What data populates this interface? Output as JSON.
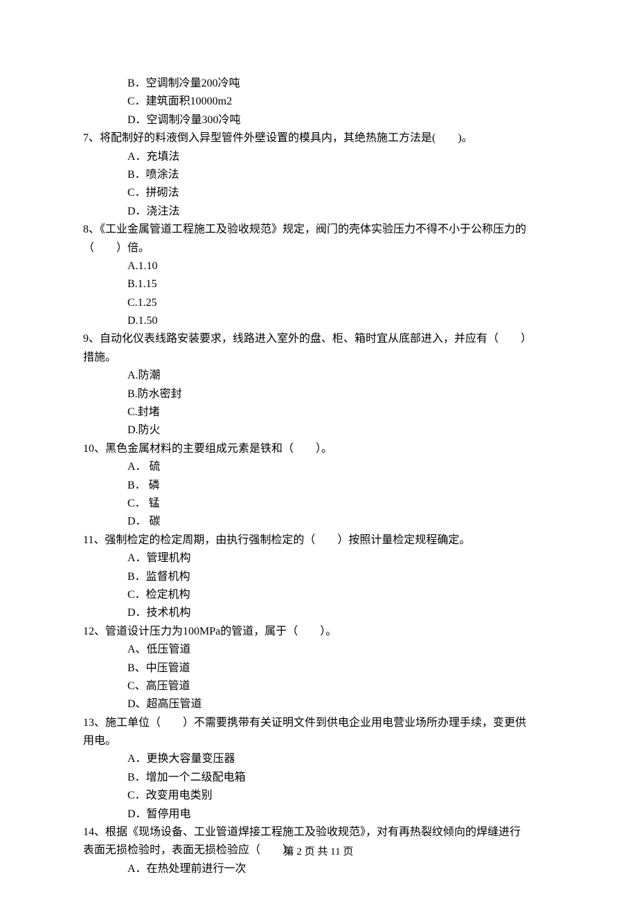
{
  "q6_options": {
    "B": "B．空调制冷量200冷吨",
    "C": "C．建筑面积10000m2",
    "D": "D．空调制冷量300冷吨"
  },
  "q7": {
    "stem": "7、将配制好的料液倒入异型管件外壁设置的模具内，其绝热施工方法是(　　)。",
    "A": "A．充填法",
    "B": "B．喷涂法",
    "C": "C．拼砌法",
    "D": "D．浇注法"
  },
  "q8": {
    "stem_line1": "8、《工业金属管道工程施工及验收规范》规定，阀门的壳体实验压力不得不小于公称压力的",
    "stem_line2": "（　　）倍。",
    "A": "A.1.10",
    "B": "B.1.15",
    "C": "C.1.25",
    "D": "D.1.50"
  },
  "q9": {
    "stem_line1": "9、自动化仪表线路安装要求，线路进入室外的盘、柜、箱时宜从底部进入，并应有（　　）",
    "stem_line2": "措施。",
    "A": "A.防潮",
    "B": "B.防水密封",
    "C": "C.封堵",
    "D": "D.防火"
  },
  "q10": {
    "stem": "10、黑色金属材料的主要组成元素是铁和（　　）。",
    "A": "A． 硫",
    "B": "B． 磷",
    "C": "C． 锰",
    "D": "D． 碳"
  },
  "q11": {
    "stem": "11、强制检定的检定周期，由执行强制检定的（　　）按照计量检定规程确定。",
    "A": "A．管理机构",
    "B": "B．监督机构",
    "C": "C．检定机构",
    "D": "D．技术机构"
  },
  "q12": {
    "stem": "12、管道设计压力为100MPa的管道，属于（　　）。",
    "A": "A、低压管道",
    "B": "B、中压管道",
    "C": "C、高压管道",
    "D": "D、超高压管道"
  },
  "q13": {
    "stem_line1": "13、施工单位（　　）不需要携带有关证明文件到供电企业用电营业场所办理手续，变更供",
    "stem_line2": "用电。",
    "A": "A．更换大容量变压器",
    "B": "B．增加一个二级配电箱",
    "C": "C．改变用电类别",
    "D": "D．暂停用电"
  },
  "q14": {
    "stem_line1": "14、根据《现场设备、工业管道焊接工程施工及验收规范》，对有再热裂纹倾向的焊缝进行",
    "stem_line2": "表面无损检验时，表面无损检验应（　　）。",
    "A": "A．在热处理前进行一次"
  },
  "footer": "第 2 页 共 11 页"
}
